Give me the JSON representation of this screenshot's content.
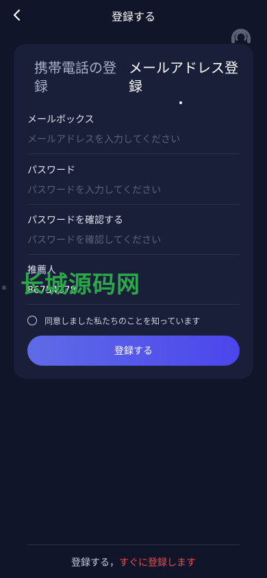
{
  "header": {
    "title": "登録する",
    "back_icon": "chevron-left-icon",
    "support_icon": "customer-service-icon"
  },
  "tabs": [
    {
      "label": "携帯電話の登録",
      "active": false
    },
    {
      "label": "メールアドレス登録",
      "active": true
    }
  ],
  "form": {
    "email": {
      "label": "メールボックス",
      "placeholder": "メールアドレスを入力してください",
      "value": ""
    },
    "password": {
      "label": "パスワード",
      "placeholder": "パスワードを入力してください",
      "value": ""
    },
    "confirm_password": {
      "label": "パスワードを確認する",
      "placeholder": "パスワードを確認してください",
      "value": ""
    },
    "referrer": {
      "label": "推薦人",
      "placeholder": "",
      "value": "86754278"
    },
    "agreement": {
      "label": "同意しました私たちのことを知っています",
      "checked": false
    },
    "submit_label": "登録する"
  },
  "watermark": {
    "text": "长城源码网",
    "mark": "®"
  },
  "footer": {
    "text": "登録する，",
    "link": "すぐに登録します"
  },
  "colors": {
    "background": "#10152a",
    "card": "#191f39",
    "button_start": "#5f6be6",
    "button_end": "#4b46ec",
    "link": "#ee4b4b",
    "watermark": "#2ca84a"
  }
}
